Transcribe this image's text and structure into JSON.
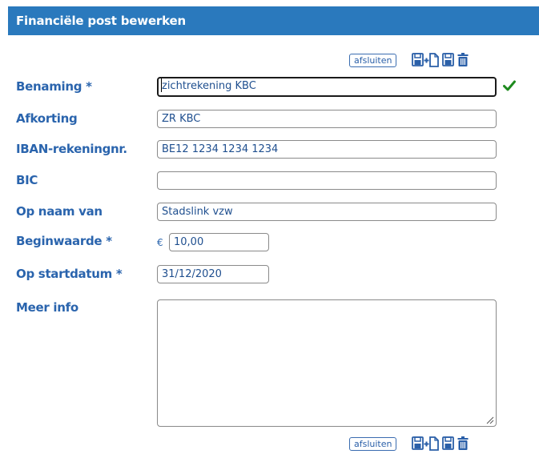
{
  "header": {
    "title": "Financiële post bewerken"
  },
  "toolbar": {
    "close_label": "afsluiten",
    "icons": [
      "save-new-icon",
      "save-icon",
      "delete-icon"
    ],
    "icon_color": "#2a5fa8"
  },
  "form": {
    "name": {
      "label": "Benaming *",
      "value": "zichtrekening KBC"
    },
    "abbreviation": {
      "label": "Afkorting",
      "value": "ZR KBC"
    },
    "iban": {
      "label": "IBAN-rekeningnr.",
      "value": "BE12 1234 1234 1234"
    },
    "bic": {
      "label": "BIC",
      "value": ""
    },
    "holder": {
      "label": "Op naam van",
      "value": "Stadslink vzw"
    },
    "initial_value": {
      "label": "Beginwaarde *",
      "currency": "€",
      "value": "10,00"
    },
    "start_date": {
      "label": "Op startdatum *",
      "value": "31/12/2020"
    },
    "more_info": {
      "label": "Meer info",
      "value": ""
    }
  },
  "colors": {
    "header_bg": "#2a79bd",
    "label": "#2a64ad",
    "valid_check": "#1e8a1e"
  }
}
